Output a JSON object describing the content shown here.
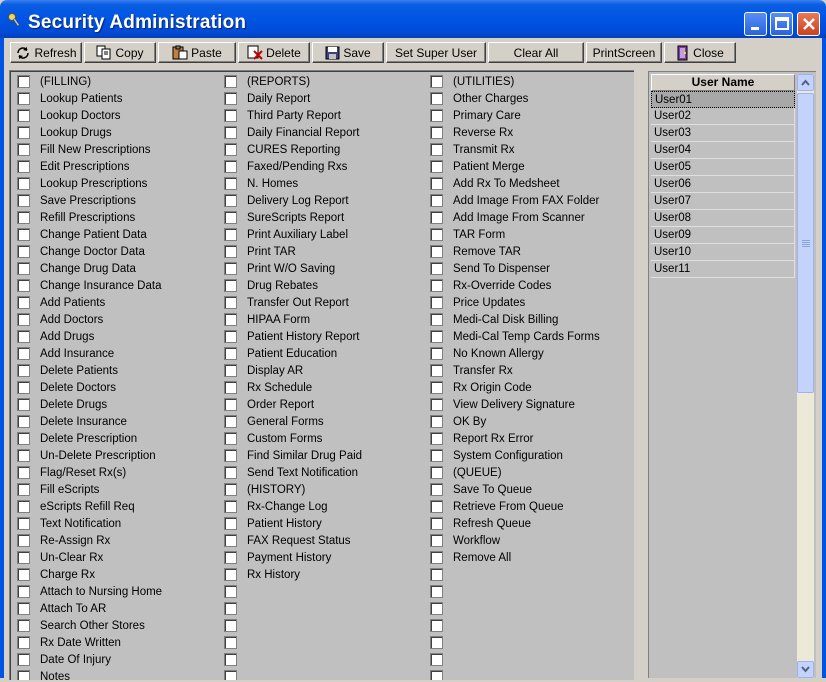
{
  "window": {
    "title": "Security Administration",
    "buttons": [
      "minimize",
      "maximize",
      "close"
    ]
  },
  "toolbar": {
    "refresh": "Refresh",
    "copy": "Copy",
    "paste": "Paste",
    "delete": "Delete",
    "save": "Save",
    "set_super_user": "Set Super User",
    "clear_all": "Clear All",
    "print_screen": "PrintScreen",
    "close": "Close"
  },
  "columns": [
    [
      "(FILLING)",
      "Lookup Patients",
      "Lookup Doctors",
      "Lookup Drugs",
      "Fill New Prescriptions",
      "Edit Prescriptions",
      "Lookup Prescriptions",
      "Save Prescriptions",
      "Refill Prescriptions",
      "Change Patient Data",
      "Change Doctor Data",
      "Change Drug Data",
      "Change Insurance Data",
      "Add Patients",
      "Add Doctors",
      "Add Drugs",
      "Add Insurance",
      "Delete Patients",
      "Delete Doctors",
      "Delete Drugs",
      "Delete Insurance",
      "Delete Prescription",
      "Un-Delete Prescription",
      "Flag/Reset Rx(s)",
      "Fill eScripts",
      "eScripts Refill Req",
      "Text Notification",
      "Re-Assign Rx",
      "Un-Clear Rx",
      "Charge Rx",
      "Attach to Nursing Home",
      "Attach To AR",
      "Search Other Stores",
      "Rx Date Written",
      "Date Of Injury",
      "Notes"
    ],
    [
      "(REPORTS)",
      "Daily Report",
      "Third Party Report",
      "Daily Financial Report",
      "CURES Reporting",
      "Faxed/Pending Rxs",
      "N. Homes",
      "Delivery Log Report",
      "SureScripts Report",
      "Print Auxiliary Label",
      "Print TAR",
      "Print W/O Saving",
      "Drug Rebates",
      "Transfer Out Report",
      "HIPAA Form",
      "Patient History Report",
      "Patient Education",
      "Display AR",
      "Rx Schedule",
      "Order Report",
      "General Forms",
      "Custom Forms",
      "Find Similar Drug Paid",
      "Send Text Notification",
      "(HISTORY)",
      "Rx-Change Log",
      "Patient History",
      "FAX Request Status",
      "Payment History",
      "Rx History",
      "",
      "",
      "",
      "",
      "",
      ""
    ],
    [
      "(UTILITIES)",
      "Other Charges",
      "Primary Care",
      "Reverse Rx",
      "Transmit Rx",
      "Patient Merge",
      "Add Rx To Medsheet",
      "Add Image From FAX Folder",
      "Add Image From Scanner",
      "TAR Form",
      "Remove TAR",
      "Send To Dispenser",
      "Rx-Override Codes",
      "Price Updates",
      "Medi-Cal Disk Billing",
      "Medi-Cal Temp Cards Forms",
      "No Known Allergy",
      "Transfer Rx",
      "Rx Origin Code",
      "View Delivery Signature",
      "OK By",
      "Report Rx Error",
      "System Configuration",
      "(QUEUE)",
      "Save To Queue",
      "Retrieve From Queue",
      "Refresh Queue",
      "Workflow",
      "Remove All",
      "",
      "",
      "",
      "",
      "",
      "",
      ""
    ]
  ],
  "users": {
    "header": "User Name",
    "rows": [
      "User01",
      "User02",
      "User03",
      "User04",
      "User05",
      "User06",
      "User07",
      "User08",
      "User09",
      "User10",
      "User11"
    ],
    "selected": "User01"
  },
  "colors": {
    "titlebar": "#0054e3",
    "panel": "#c0c0c0",
    "selected_row": "#a8a8a8"
  }
}
